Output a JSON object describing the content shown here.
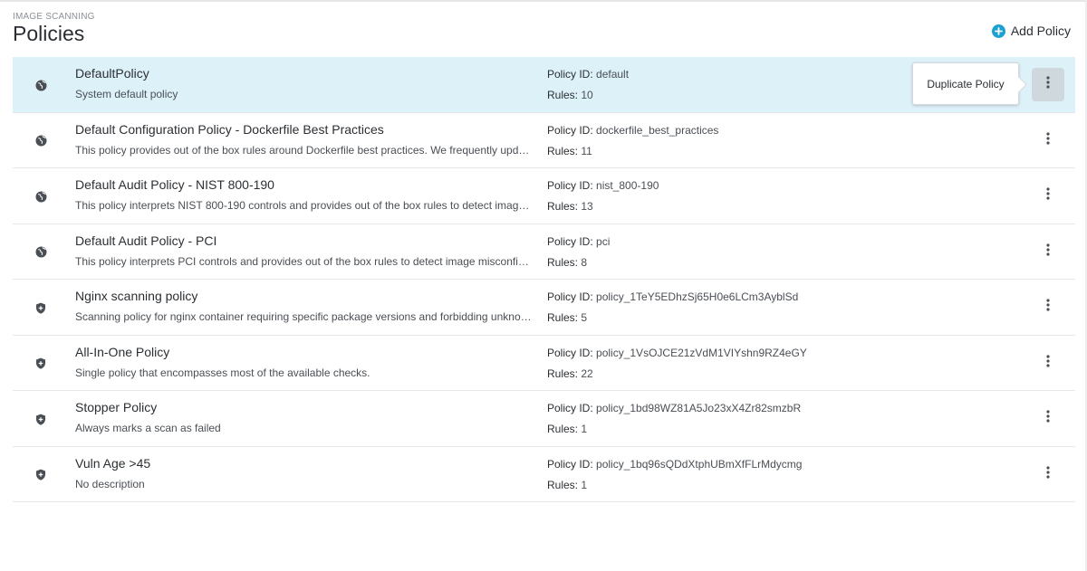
{
  "header": {
    "eyebrow": "IMAGE SCANNING",
    "title": "Policies",
    "add_label": "Add Policy"
  },
  "labels": {
    "policy_id": "Policy ID:",
    "rules": "Rules:"
  },
  "tooltip": "Duplicate Policy",
  "policies": [
    {
      "icon": "globe-icon",
      "name": "DefaultPolicy",
      "description": "System default policy",
      "policy_id": "default",
      "rules": "10",
      "selected": true
    },
    {
      "icon": "globe-icon",
      "name": "Default Configuration Policy - Dockerfile Best Practices",
      "description": "This policy provides out of the box rules around Dockerfile best practices. We frequently upd…",
      "policy_id": "dockerfile_best_practices",
      "rules": "11"
    },
    {
      "icon": "globe-icon",
      "name": "Default Audit Policy - NIST 800-190",
      "description": "This policy interprets NIST 800-190 controls and provides out of the box rules to detect imag…",
      "policy_id": "nist_800-190",
      "rules": "13"
    },
    {
      "icon": "globe-icon",
      "name": "Default Audit Policy - PCI",
      "description": "This policy interprets PCI controls and provides out of the box rules to detect image misconfi…",
      "policy_id": "pci",
      "rules": "8"
    },
    {
      "icon": "shield-icon",
      "name": "Nginx scanning policy",
      "description": "Scanning policy for nginx container requiring specific package versions and forbidding unkno…",
      "policy_id": "policy_1TeY5EDhzSj65H0e6LCm3AyblSd",
      "rules": "5"
    },
    {
      "icon": "shield-icon",
      "name": "All-In-One Policy",
      "description": "Single policy that encompasses most of the available checks.",
      "policy_id": "policy_1VsOJCE21zVdM1VIYshn9RZ4eGY",
      "rules": "22"
    },
    {
      "icon": "shield-icon",
      "name": "Stopper Policy",
      "description": "Always marks a scan as failed",
      "policy_id": "policy_1bd98WZ81A5Jo23xX4Zr82smzbR",
      "rules": "1"
    },
    {
      "icon": "shield-icon",
      "name": "Vuln Age >45",
      "description": "No description",
      "policy_id": "policy_1bq96sQDdXtphUBmXfFLrMdycmg",
      "rules": "1"
    }
  ]
}
